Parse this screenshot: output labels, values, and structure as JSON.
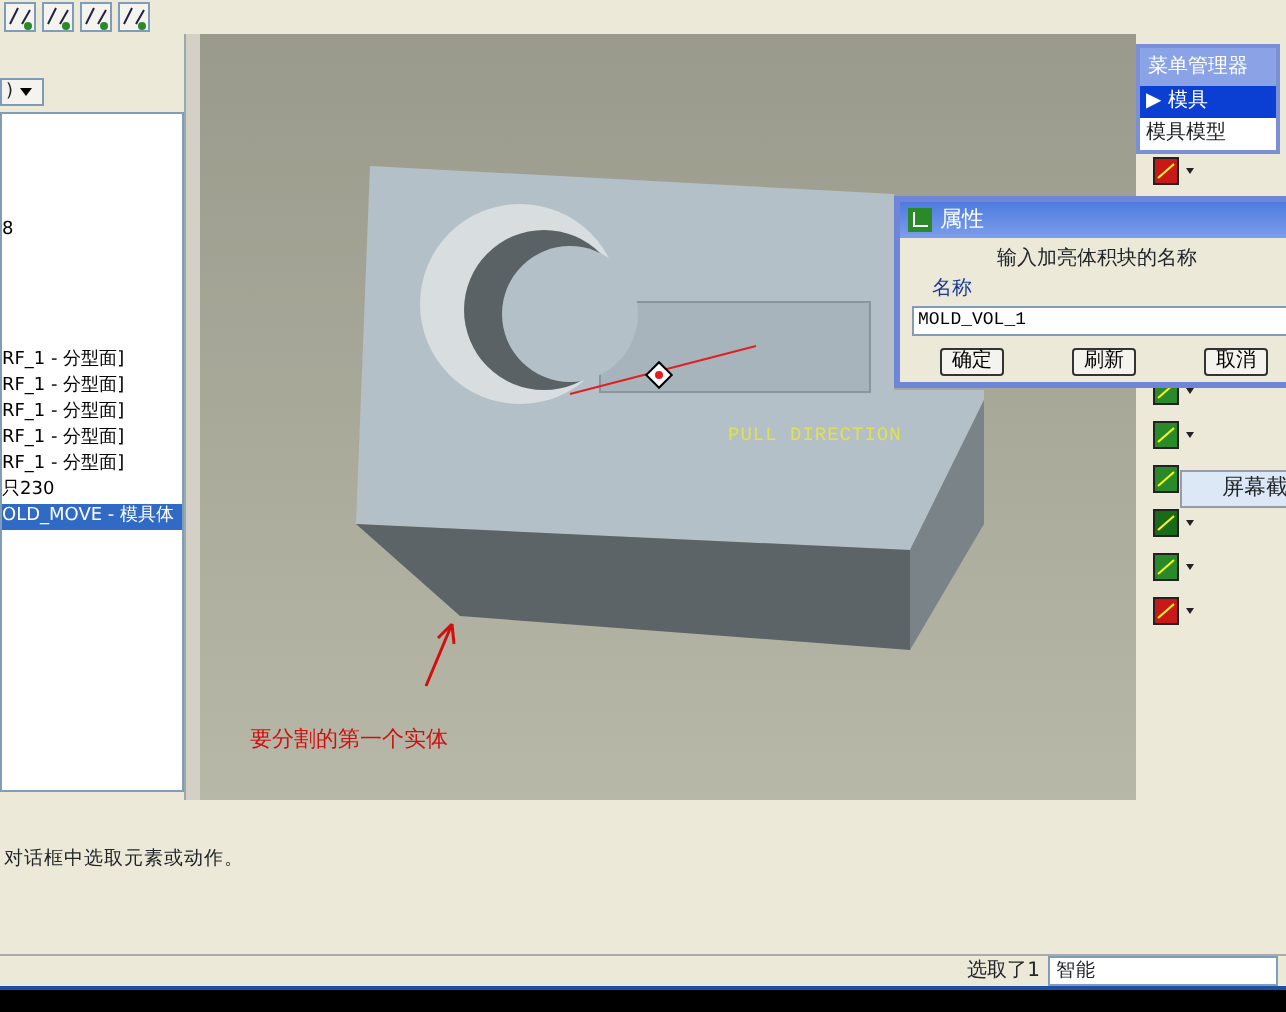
{
  "model_tree": {
    "dropdown": ")",
    "items": [
      {
        "label": "8",
        "selected": false
      },
      {
        "label": "RF_1 - 分型面]",
        "selected": false
      },
      {
        "label": "RF_1 - 分型面]",
        "selected": false
      },
      {
        "label": "RF_1 - 分型面]",
        "selected": false
      },
      {
        "label": "RF_1 - 分型面]",
        "selected": false
      },
      {
        "label": "RF_1 - 分型面]",
        "selected": false
      },
      {
        "label": "只230",
        "selected": false
      },
      {
        "label": "OLD_MOVE - 模具体",
        "selected": true
      }
    ]
  },
  "viewport": {
    "direction_label": "PULL DIRECTION",
    "annotation": "要分割的第一个实体"
  },
  "menu_manager": {
    "title": "菜单管理器",
    "items": [
      {
        "label": "模具",
        "selected": true,
        "arrow": "▶"
      },
      {
        "label": "模具模型",
        "selected": false
      }
    ]
  },
  "dialog": {
    "title": "属性",
    "prompt": "输入加亮体积块的名称",
    "field_label": "名称",
    "value": "MOLD_VOL_1",
    "buttons": [
      "确定",
      "刷新",
      "取消"
    ]
  },
  "tooltip": "屏幕截",
  "message": "对话框中选取元素或动作。",
  "status_bar": {
    "selection": "选取了1",
    "filter": "智能"
  }
}
